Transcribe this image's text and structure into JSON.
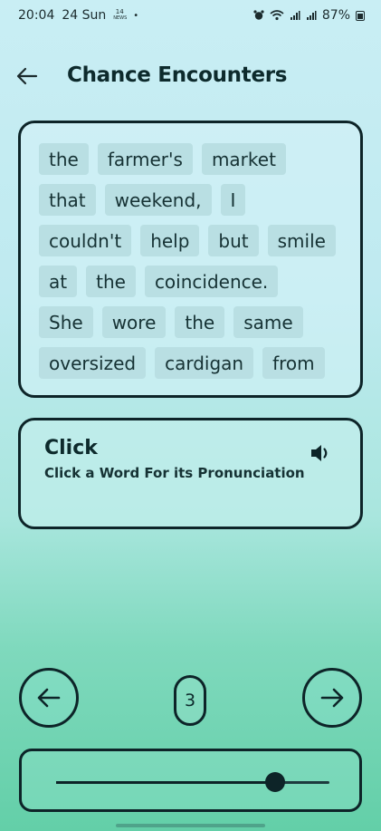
{
  "status_bar": {
    "time": "20:04",
    "day": "24 Sun",
    "notif_badge_top": "14",
    "notif_badge_bottom": "NEWS",
    "dot": "•",
    "battery": "87%"
  },
  "header": {
    "title": "Chance Encounters",
    "back_icon": "arrow-left-icon"
  },
  "passage": {
    "rows": [
      [
        "the",
        "farmer's",
        "market"
      ],
      [
        "that",
        "weekend,",
        "I"
      ],
      [
        "couldn't",
        "help",
        "but",
        "smile"
      ],
      [
        "at",
        "the",
        "coincidence."
      ],
      [
        "She",
        "wore",
        "the",
        "same"
      ],
      [
        "oversized",
        "cardigan",
        "from"
      ]
    ]
  },
  "pronunciation": {
    "title": "Click",
    "subtitle": "Click a Word For its Pronunciation",
    "speaker_icon": "speaker-icon"
  },
  "navigation": {
    "prev_icon": "arrow-left-icon",
    "next_icon": "arrow-right-icon",
    "page": "3"
  },
  "slider": {
    "value_fraction": 0.8
  }
}
